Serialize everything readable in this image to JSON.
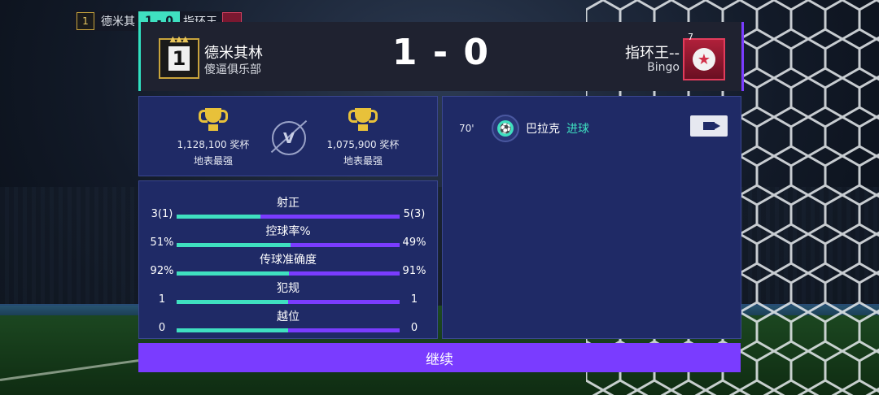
{
  "mini_scoreboard": {
    "home_crest_number": "1",
    "home_name": "德米其",
    "score": "1 - 0",
    "away_name": "指环王"
  },
  "header": {
    "home_rank_number": "1",
    "home_name": "德米其林",
    "home_club": "傻逼俱乐部",
    "score": "1 - 0",
    "away_name": "指环王--",
    "away_club": "Bingo",
    "away_badge_tag": "7"
  },
  "trophies": {
    "home": {
      "count": "1,128,100 奖杯",
      "rank": "地表最强"
    },
    "vs": "V",
    "away": {
      "count": "1,075,900 奖杯",
      "rank": "地表最强"
    }
  },
  "stats": [
    {
      "label": "射正",
      "home": "3(1)",
      "away": "5(3)",
      "home_share": 0.375
    },
    {
      "label": "控球率%",
      "home": "51%",
      "away": "49%",
      "home_share": 0.51
    },
    {
      "label": "传球准确度",
      "home": "92%",
      "away": "91%",
      "home_share": 0.503
    },
    {
      "label": "犯规",
      "home": "1",
      "away": "1",
      "home_share": 0.5
    },
    {
      "label": "越位",
      "home": "0",
      "away": "0",
      "home_share": 0.5
    }
  ],
  "events": [
    {
      "minute": "70'",
      "player": "巴拉克",
      "type": "进球",
      "icon": "soccer-ball-icon"
    }
  ],
  "continue_label": "继续",
  "colors": {
    "home": "#3fe0c0",
    "away": "#7a3cff",
    "panel": "#1f2a66"
  }
}
